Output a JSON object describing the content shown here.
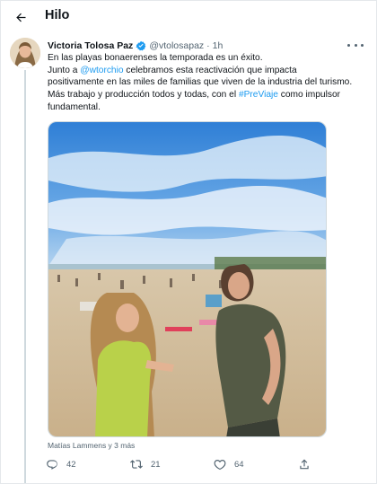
{
  "header": {
    "title": "Hilo"
  },
  "tweet": {
    "author": {
      "name": "Victoria Tolosa Paz",
      "handle": "@vtolosapaz",
      "separator": "·",
      "time": "1h",
      "verified": true
    },
    "text": {
      "line1": "En las playas bonaerenses la temporada es un éxito.",
      "line2_pre": "Junto a ",
      "line2_mention": "@wtorchio",
      "line2_post": " celebramos esta reactivación que impacta",
      "line3": "positivamente en las miles de familias que viven de la industria del turismo.",
      "line4_pre": "Más trabajo y producción todos y todas, con el ",
      "line4_hashtag": "#PreViaje",
      "line4_post": " como impulsor",
      "line5": "fundamental."
    },
    "media": {
      "description_icon": "photo"
    },
    "tagged": "Matías Lammens y 3 más",
    "stats": {
      "replies": "42",
      "retweets": "21",
      "likes": "64"
    }
  },
  "colors": {
    "accent": "#1d9bf0",
    "text": "#0f1419",
    "muted": "#536471",
    "border": "#cfd9de"
  },
  "icons": {
    "back": "arrow-left-icon",
    "verified": "verified-badge-icon",
    "more": "more-dots-icon",
    "reply": "reply-icon",
    "retweet": "retweet-icon",
    "like": "heart-icon",
    "share": "share-icon"
  }
}
